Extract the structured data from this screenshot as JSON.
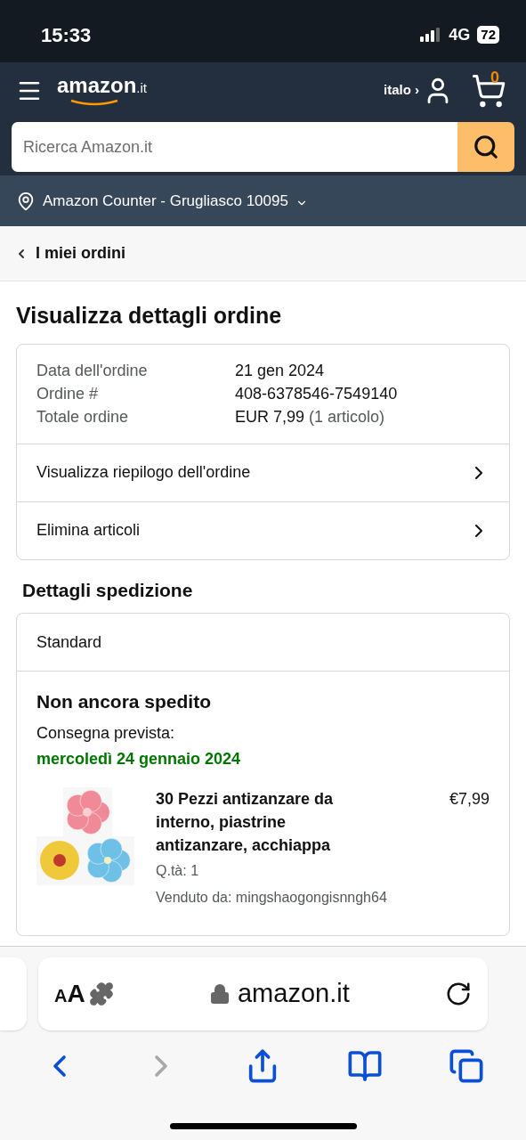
{
  "status_bar": {
    "time": "15:33",
    "network": "4G",
    "battery": "72"
  },
  "header": {
    "logo": "amazon",
    "logo_suffix": ".it",
    "account": "italo ›",
    "cart_count": "0"
  },
  "search": {
    "placeholder": "Ricerca Amazon.it"
  },
  "location": {
    "text": "Amazon Counter - Grugliasco 10095"
  },
  "breadcrumb": {
    "label": "I miei ordini"
  },
  "page_title": "Visualizza dettagli ordine",
  "order_summary": {
    "rows": [
      {
        "label": "Data dell'ordine",
        "value": "21 gen 2024"
      },
      {
        "label": "Ordine #",
        "value": "408-6378546-7549140"
      },
      {
        "label": "Totale ordine",
        "value": "EUR 7,99",
        "note": "(1 articolo)"
      }
    ],
    "links": [
      "Visualizza riepilogo dell'ordine",
      "Elimina articoli"
    ]
  },
  "shipping": {
    "heading": "Dettagli spedizione",
    "method": "Standard",
    "status": "Non ancora spedito",
    "delivery_label": "Consegna prevista:",
    "delivery_date": "mercoledì 24 gennaio 2024",
    "item": {
      "title": "30 Pezzi antizanzare da interno, piastrine antizanzare, acchiappa",
      "price": "€7,99",
      "quantity": "Q.tà: 1",
      "seller": "Venduto da: mingshaogongisnngh64"
    }
  },
  "browser": {
    "text_size": "AA",
    "url": "amazon.it",
    "nav": [
      {
        "kind": "back",
        "disabled": false
      },
      {
        "kind": "forward",
        "disabled": true
      },
      {
        "kind": "share",
        "disabled": false
      },
      {
        "kind": "bookmarks",
        "disabled": false
      },
      {
        "kind": "tabs",
        "disabled": false
      }
    ]
  }
}
